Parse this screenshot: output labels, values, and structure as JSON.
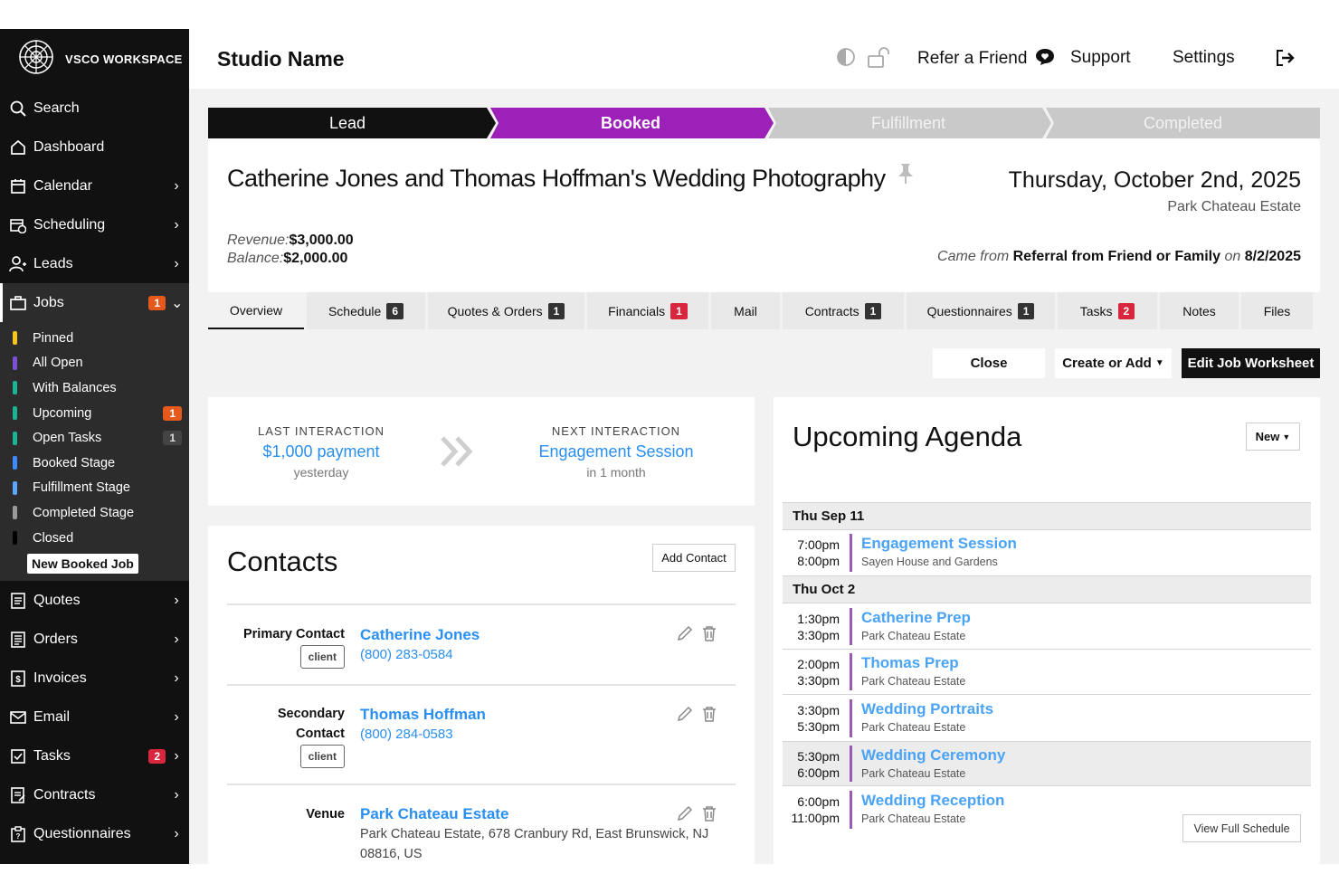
{
  "brand": {
    "name": "VSCO WORKSPACE"
  },
  "sidebar": {
    "items": [
      {
        "label": "Search",
        "icon": "search-icon"
      },
      {
        "label": "Dashboard",
        "icon": "home-icon"
      },
      {
        "label": "Calendar",
        "icon": "calendar-icon"
      },
      {
        "label": "Scheduling",
        "icon": "calendar-clock-icon"
      },
      {
        "label": "Leads",
        "icon": "user-plus-icon"
      },
      {
        "label": "Jobs",
        "icon": "briefcase-icon",
        "badge": "1"
      }
    ],
    "jobs_sub": [
      {
        "label": "Pinned",
        "color": "#f5c518",
        "count": ""
      },
      {
        "label": "All Open",
        "color": "#7b4fd6",
        "count": ""
      },
      {
        "label": "With Balances",
        "color": "#1ab394",
        "count": ""
      },
      {
        "label": "Upcoming",
        "color": "#1ab394",
        "count": "1"
      },
      {
        "label": "Open Tasks",
        "color": "#1ab394",
        "count": "1"
      },
      {
        "label": "Booked Stage",
        "color": "#3d8bfd",
        "count": ""
      },
      {
        "label": "Fulfillment Stage",
        "color": "#5aa7ff",
        "count": ""
      },
      {
        "label": "Completed Stage",
        "color": "#9a9a9a",
        "count": ""
      },
      {
        "label": "Closed",
        "color": "#000000",
        "count": ""
      }
    ],
    "new_booked_job": "New Booked Job",
    "lower_items": [
      {
        "label": "Quotes",
        "icon": "quote-doc-icon"
      },
      {
        "label": "Orders",
        "icon": "orders-doc-icon"
      },
      {
        "label": "Invoices",
        "icon": "invoice-icon"
      },
      {
        "label": "Email",
        "icon": "mail-icon"
      },
      {
        "label": "Tasks",
        "icon": "checkbox-icon",
        "badge": "2"
      },
      {
        "label": "Contracts",
        "icon": "contract-icon"
      },
      {
        "label": "Questionnaires",
        "icon": "clipboard-icon"
      }
    ]
  },
  "topbar": {
    "studio_name": "Studio Name",
    "refer": "Refer a Friend",
    "support": "Support",
    "settings": "Settings"
  },
  "stages": [
    {
      "label": "Lead",
      "state": "done"
    },
    {
      "label": "Booked",
      "state": "current"
    },
    {
      "label": "Fulfillment",
      "state": "future"
    },
    {
      "label": "Completed",
      "state": "future"
    }
  ],
  "job": {
    "title": "Catherine Jones and Thomas Hoffman's Wedding Photography",
    "date": "Thursday, October 2nd, 2025",
    "venue": "Park Chateau Estate",
    "revenue_label": "Revenue:",
    "revenue": "$3,000.00",
    "balance_label": "Balance:",
    "balance": "$2,000.00",
    "came_from_label": "Came from",
    "source": "Referral from Friend or Family",
    "on_label": "on",
    "source_date": "8/2/2025"
  },
  "tabs": [
    {
      "label": "Overview",
      "count": ""
    },
    {
      "label": "Schedule",
      "count": "6"
    },
    {
      "label": "Quotes & Orders",
      "count": "1"
    },
    {
      "label": "Financials",
      "count": "1"
    },
    {
      "label": "Mail",
      "count": ""
    },
    {
      "label": "Contracts",
      "count": "1"
    },
    {
      "label": "Questionnaires",
      "count": "1"
    },
    {
      "label": "Tasks",
      "count": "2"
    },
    {
      "label": "Notes",
      "count": ""
    },
    {
      "label": "Files",
      "count": ""
    }
  ],
  "actions": {
    "close": "Close",
    "create": "Create or Add",
    "edit": "Edit Job Worksheet"
  },
  "interaction": {
    "last_h": "LAST INTERACTION",
    "last_v": "$1,000 payment",
    "last_s": "yesterday",
    "next_h": "NEXT INTERACTION",
    "next_v": "Engagement Session",
    "next_s": "in 1 month"
  },
  "contacts": {
    "title": "Contacts",
    "add": "Add Contact",
    "client_tag": "client",
    "primary_label": "Primary Contact",
    "primary_name": "Catherine Jones",
    "primary_phone": "(800) 283-0584",
    "secondary_label_1": "Secondary",
    "secondary_label_2": "Contact",
    "secondary_name": "Thomas Hoffman",
    "secondary_phone": "(800) 284-0583",
    "venue_label": "Venue",
    "venue_name": "Park Chateau Estate",
    "venue_address": "Park Chateau Estate, 678 Cranbury Rd, East Brunswick, NJ 08816, US"
  },
  "agenda": {
    "title": "Upcoming Agenda",
    "new": "New",
    "view_full": "View Full Schedule",
    "day1": "Thu Sep 11",
    "day2": "Thu Oct 2",
    "events": [
      {
        "start": "7:00pm",
        "end": "8:00pm",
        "name": "Engagement Session",
        "loc": "Sayen House and Gardens"
      },
      {
        "start": "1:30pm",
        "end": "3:30pm",
        "name": "Catherine Prep",
        "loc": "Park Chateau Estate"
      },
      {
        "start": "2:00pm",
        "end": "3:30pm",
        "name": "Thomas Prep",
        "loc": "Park Chateau Estate"
      },
      {
        "start": "3:30pm",
        "end": "5:30pm",
        "name": "Wedding Portraits",
        "loc": "Park Chateau Estate"
      },
      {
        "start": "5:30pm",
        "end": "6:00pm",
        "name": "Wedding Ceremony",
        "loc": "Park Chateau Estate"
      },
      {
        "start": "6:00pm",
        "end": "11:00pm",
        "name": "Wedding Reception",
        "loc": "Park Chateau Estate"
      }
    ]
  }
}
